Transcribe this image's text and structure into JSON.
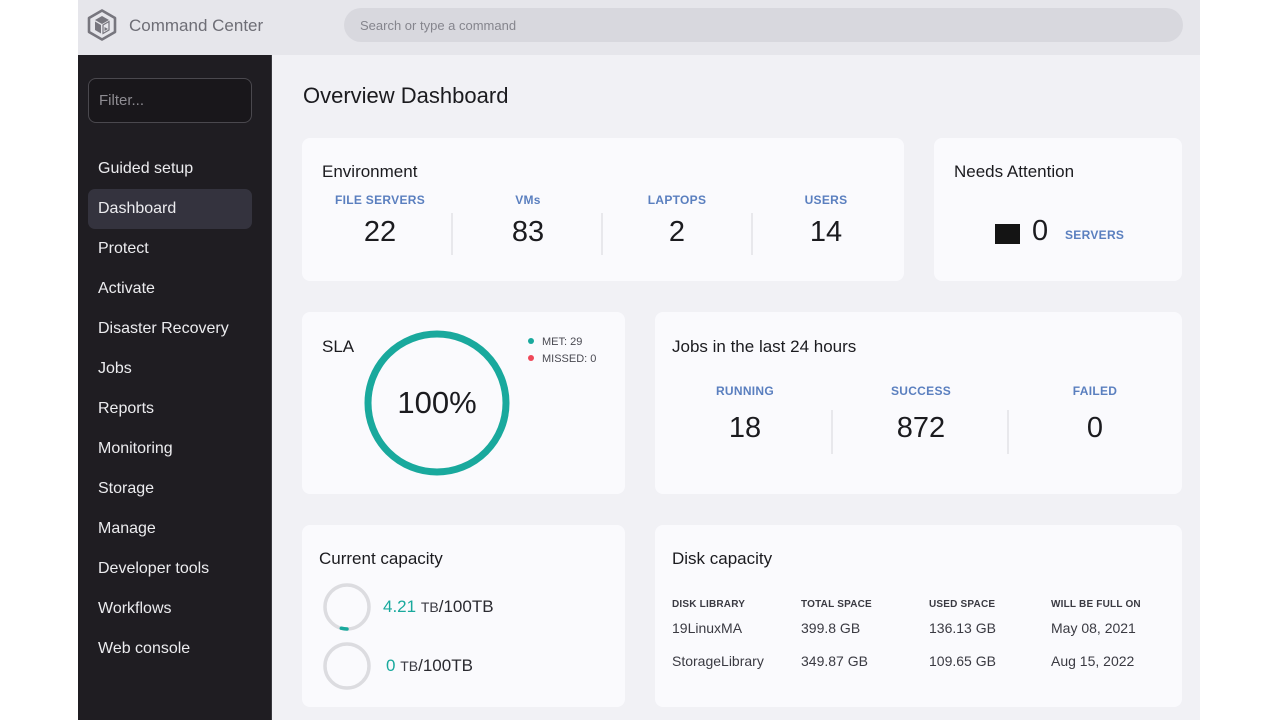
{
  "app": {
    "title": "Command Center",
    "logo_icon": "cube-icon",
    "search": {
      "placeholder": "Search or type a command",
      "value": ""
    }
  },
  "sidebar": {
    "filter": {
      "placeholder": "Filter...",
      "value": ""
    },
    "items": [
      {
        "label": "Guided setup",
        "active": false
      },
      {
        "label": "Dashboard",
        "active": true
      },
      {
        "label": "Protect",
        "active": false
      },
      {
        "label": "Activate",
        "active": false
      },
      {
        "label": "Disaster Recovery",
        "active": false
      },
      {
        "label": "Jobs",
        "active": false
      },
      {
        "label": "Reports",
        "active": false
      },
      {
        "label": "Monitoring",
        "active": false
      },
      {
        "label": "Storage",
        "active": false
      },
      {
        "label": "Manage",
        "active": false
      },
      {
        "label": "Developer tools",
        "active": false
      },
      {
        "label": "Workflows",
        "active": false
      },
      {
        "label": "Web console",
        "active": false
      }
    ]
  },
  "main": {
    "page_title": "Overview Dashboard",
    "environment": {
      "title": "Environment",
      "stats": [
        {
          "label": "FILE SERVERS",
          "value": "22"
        },
        {
          "label": "VMs",
          "value": "83"
        },
        {
          "label": "LAPTOPS",
          "value": "2"
        },
        {
          "label": "USERS",
          "value": "14"
        }
      ]
    },
    "needs_attention": {
      "title": "Needs Attention",
      "value": "0",
      "label": "SERVERS",
      "icon": "server-square-icon"
    },
    "sla": {
      "title": "SLA",
      "percent_text": "100%",
      "percent": 100,
      "legend": [
        {
          "label": "MET: 29",
          "color": "#19a99d"
        },
        {
          "label": "MISSED: 0",
          "color": "#ef4758"
        }
      ]
    },
    "jobs": {
      "title": "Jobs in the last 24 hours",
      "stats": [
        {
          "label": "RUNNING",
          "value": "18"
        },
        {
          "label": "SUCCESS",
          "value": "872"
        },
        {
          "label": "FAILED",
          "value": "0"
        }
      ]
    },
    "current_capacity": {
      "title": "Current capacity",
      "rows": [
        {
          "used": "4.21",
          "unit": "TB",
          "total": "100TB",
          "fraction": 0.0421
        },
        {
          "used": "0",
          "unit": "TB",
          "total": "100TB",
          "fraction": 0
        }
      ]
    },
    "disk_capacity": {
      "title": "Disk capacity",
      "columns": [
        "DISK LIBRARY",
        "TOTAL SPACE",
        "USED SPACE",
        "WILL BE FULL ON"
      ],
      "rows": [
        [
          "19LinuxMA",
          "399.8 GB",
          "136.13 GB",
          "May 08, 2021"
        ],
        [
          "StorageLibrary",
          "349.87 GB",
          "109.65 GB",
          "Aug 15, 2022"
        ]
      ]
    }
  },
  "colors": {
    "accent_teal": "#19a99d",
    "label_blue": "#5a7fbf",
    "missed_red": "#ef4758",
    "sidebar_bg": "#1f1d22"
  }
}
